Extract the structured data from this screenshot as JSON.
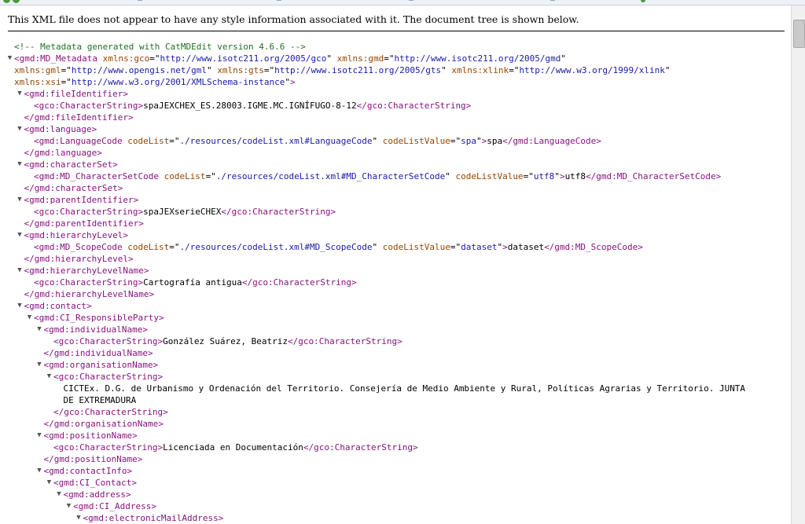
{
  "browser": {
    "info_message": "This XML file does not appear to have any style information associated with it. The document tree is shown below."
  },
  "icons": {
    "expand": "triangle-down-icon"
  },
  "xml_lines": [
    {
      "d": 0,
      "t": false,
      "s": [
        {
          "c": "cm",
          "v": "<!-- Metadata generated with CatMDEdit version 4.6.6 -->"
        }
      ]
    },
    {
      "d": 0,
      "t": true,
      "s": [
        {
          "c": "tag",
          "v": "<gmd:MD_Metadata"
        },
        {
          "c": "an",
          "v": " xmlns:gco"
        },
        {
          "c": "tx",
          "v": "=\""
        },
        {
          "c": "av",
          "v": "http://www.isotc211.org/2005/gco"
        },
        {
          "c": "tx",
          "v": "\""
        },
        {
          "c": "an",
          "v": " xmlns:gmd"
        },
        {
          "c": "tx",
          "v": "=\""
        },
        {
          "c": "av",
          "v": "http://www.isotc211.org/2005/gmd"
        },
        {
          "c": "tx",
          "v": "\""
        }
      ]
    },
    {
      "d": 0,
      "t": false,
      "s": [
        {
          "c": "an",
          "v": "xmlns:gml"
        },
        {
          "c": "tx",
          "v": "=\""
        },
        {
          "c": "av",
          "v": "http://www.opengis.net/gml"
        },
        {
          "c": "tx",
          "v": "\""
        },
        {
          "c": "an",
          "v": " xmlns:gts"
        },
        {
          "c": "tx",
          "v": "=\""
        },
        {
          "c": "av",
          "v": "http://www.isotc211.org/2005/gts"
        },
        {
          "c": "tx",
          "v": "\""
        },
        {
          "c": "an",
          "v": " xmlns:xlink"
        },
        {
          "c": "tx",
          "v": "=\""
        },
        {
          "c": "av",
          "v": "http://www.w3.org/1999/xlink"
        },
        {
          "c": "tx",
          "v": "\""
        }
      ]
    },
    {
      "d": 0,
      "t": false,
      "s": [
        {
          "c": "an",
          "v": "xmlns:xsi"
        },
        {
          "c": "tx",
          "v": "=\""
        },
        {
          "c": "av",
          "v": "http://www.w3.org/2001/XMLSchema-instance"
        },
        {
          "c": "tx",
          "v": "\""
        },
        {
          "c": "tag",
          "v": ">"
        }
      ]
    },
    {
      "d": 1,
      "t": true,
      "s": [
        {
          "c": "tag",
          "v": "<gmd:fileIdentifier>"
        }
      ]
    },
    {
      "d": 2,
      "t": false,
      "s": [
        {
          "c": "tag",
          "v": "<gco:CharacterString>"
        },
        {
          "c": "tx",
          "v": "spaJEXCHEX_ES.28003.IGME.MC.IGNÍFUGO-8-12"
        },
        {
          "c": "tag",
          "v": "</gco:CharacterString>"
        }
      ]
    },
    {
      "d": 1,
      "t": false,
      "s": [
        {
          "c": "tag",
          "v": "</gmd:fileIdentifier>"
        }
      ]
    },
    {
      "d": 1,
      "t": true,
      "s": [
        {
          "c": "tag",
          "v": "<gmd:language>"
        }
      ]
    },
    {
      "d": 2,
      "t": false,
      "s": [
        {
          "c": "tag",
          "v": "<gmd:LanguageCode"
        },
        {
          "c": "an",
          "v": " codeList"
        },
        {
          "c": "tx",
          "v": "=\""
        },
        {
          "c": "av",
          "v": "./resources/codeList.xml#LanguageCode"
        },
        {
          "c": "tx",
          "v": "\""
        },
        {
          "c": "an",
          "v": " codeListValue"
        },
        {
          "c": "tx",
          "v": "=\""
        },
        {
          "c": "av",
          "v": "spa"
        },
        {
          "c": "tx",
          "v": "\""
        },
        {
          "c": "tag",
          "v": ">"
        },
        {
          "c": "tx",
          "v": "spa"
        },
        {
          "c": "tag",
          "v": "</gmd:LanguageCode>"
        }
      ]
    },
    {
      "d": 1,
      "t": false,
      "s": [
        {
          "c": "tag",
          "v": "</gmd:language>"
        }
      ]
    },
    {
      "d": 1,
      "t": true,
      "s": [
        {
          "c": "tag",
          "v": "<gmd:characterSet>"
        }
      ]
    },
    {
      "d": 2,
      "t": false,
      "s": [
        {
          "c": "tag",
          "v": "<gmd:MD_CharacterSetCode"
        },
        {
          "c": "an",
          "v": " codeList"
        },
        {
          "c": "tx",
          "v": "=\""
        },
        {
          "c": "av",
          "v": "./resources/codeList.xml#MD_CharacterSetCode"
        },
        {
          "c": "tx",
          "v": "\""
        },
        {
          "c": "an",
          "v": " codeListValue"
        },
        {
          "c": "tx",
          "v": "=\""
        },
        {
          "c": "av",
          "v": "utf8"
        },
        {
          "c": "tx",
          "v": "\""
        },
        {
          "c": "tag",
          "v": ">"
        },
        {
          "c": "tx",
          "v": "utf8"
        },
        {
          "c": "tag",
          "v": "</gmd:MD_CharacterSetCode>"
        }
      ]
    },
    {
      "d": 1,
      "t": false,
      "s": [
        {
          "c": "tag",
          "v": "</gmd:characterSet>"
        }
      ]
    },
    {
      "d": 1,
      "t": true,
      "s": [
        {
          "c": "tag",
          "v": "<gmd:parentIdentifier>"
        }
      ]
    },
    {
      "d": 2,
      "t": false,
      "s": [
        {
          "c": "tag",
          "v": "<gco:CharacterString>"
        },
        {
          "c": "tx",
          "v": "spaJEXserieCHEX"
        },
        {
          "c": "tag",
          "v": "</gco:CharacterString>"
        }
      ]
    },
    {
      "d": 1,
      "t": false,
      "s": [
        {
          "c": "tag",
          "v": "</gmd:parentIdentifier>"
        }
      ]
    },
    {
      "d": 1,
      "t": true,
      "s": [
        {
          "c": "tag",
          "v": "<gmd:hierarchyLevel>"
        }
      ]
    },
    {
      "d": 2,
      "t": false,
      "s": [
        {
          "c": "tag",
          "v": "<gmd:MD_ScopeCode"
        },
        {
          "c": "an",
          "v": " codeList"
        },
        {
          "c": "tx",
          "v": "=\""
        },
        {
          "c": "av",
          "v": "./resources/codeList.xml#MD_ScopeCode"
        },
        {
          "c": "tx",
          "v": "\""
        },
        {
          "c": "an",
          "v": " codeListValue"
        },
        {
          "c": "tx",
          "v": "=\""
        },
        {
          "c": "av",
          "v": "dataset"
        },
        {
          "c": "tx",
          "v": "\""
        },
        {
          "c": "tag",
          "v": ">"
        },
        {
          "c": "tx",
          "v": "dataset"
        },
        {
          "c": "tag",
          "v": "</gmd:MD_ScopeCode>"
        }
      ]
    },
    {
      "d": 1,
      "t": false,
      "s": [
        {
          "c": "tag",
          "v": "</gmd:hierarchyLevel>"
        }
      ]
    },
    {
      "d": 1,
      "t": true,
      "s": [
        {
          "c": "tag",
          "v": "<gmd:hierarchyLevelName>"
        }
      ]
    },
    {
      "d": 2,
      "t": false,
      "s": [
        {
          "c": "tag",
          "v": "<gco:CharacterString>"
        },
        {
          "c": "tx",
          "v": "Cartografía antigua"
        },
        {
          "c": "tag",
          "v": "</gco:CharacterString>"
        }
      ]
    },
    {
      "d": 1,
      "t": false,
      "s": [
        {
          "c": "tag",
          "v": "</gmd:hierarchyLevelName>"
        }
      ]
    },
    {
      "d": 1,
      "t": true,
      "s": [
        {
          "c": "tag",
          "v": "<gmd:contact>"
        }
      ]
    },
    {
      "d": 2,
      "t": true,
      "s": [
        {
          "c": "tag",
          "v": "<gmd:CI_ResponsibleParty>"
        }
      ]
    },
    {
      "d": 3,
      "t": true,
      "s": [
        {
          "c": "tag",
          "v": "<gmd:individualName>"
        }
      ]
    },
    {
      "d": 4,
      "t": false,
      "s": [
        {
          "c": "tag",
          "v": "<gco:CharacterString>"
        },
        {
          "c": "tx",
          "v": "González Suárez, Beatriz"
        },
        {
          "c": "tag",
          "v": "</gco:CharacterString>"
        }
      ]
    },
    {
      "d": 3,
      "t": false,
      "s": [
        {
          "c": "tag",
          "v": "</gmd:individualName>"
        }
      ]
    },
    {
      "d": 3,
      "t": true,
      "s": [
        {
          "c": "tag",
          "v": "<gmd:organisationName>"
        }
      ]
    },
    {
      "d": 4,
      "t": true,
      "s": [
        {
          "c": "tag",
          "v": "<gco:CharacterString>"
        }
      ]
    },
    {
      "d": 5,
      "t": false,
      "s": [
        {
          "c": "tx",
          "v": "CICTEx. D.G. de Urbanismo y Ordenación del Territorio. Consejería de Medio Ambiente y Rural, Políticas Agrarias y Territorio. JUNTA"
        }
      ]
    },
    {
      "d": 5,
      "t": false,
      "s": [
        {
          "c": "tx",
          "v": "DE EXTREMADURA"
        }
      ]
    },
    {
      "d": 4,
      "t": false,
      "s": [
        {
          "c": "tag",
          "v": "</gco:CharacterString>"
        }
      ]
    },
    {
      "d": 3,
      "t": false,
      "s": [
        {
          "c": "tag",
          "v": "</gmd:organisationName>"
        }
      ]
    },
    {
      "d": 3,
      "t": true,
      "s": [
        {
          "c": "tag",
          "v": "<gmd:positionName>"
        }
      ]
    },
    {
      "d": 4,
      "t": false,
      "s": [
        {
          "c": "tag",
          "v": "<gco:CharacterString>"
        },
        {
          "c": "tx",
          "v": "Licenciada en Documentación"
        },
        {
          "c": "tag",
          "v": "</gco:CharacterString>"
        }
      ]
    },
    {
      "d": 3,
      "t": false,
      "s": [
        {
          "c": "tag",
          "v": "</gmd:positionName>"
        }
      ]
    },
    {
      "d": 3,
      "t": true,
      "s": [
        {
          "c": "tag",
          "v": "<gmd:contactInfo>"
        }
      ]
    },
    {
      "d": 4,
      "t": true,
      "s": [
        {
          "c": "tag",
          "v": "<gmd:CI_Contact>"
        }
      ]
    },
    {
      "d": 5,
      "t": true,
      "s": [
        {
          "c": "tag",
          "v": "<gmd:address>"
        }
      ]
    },
    {
      "d": 6,
      "t": true,
      "s": [
        {
          "c": "tag",
          "v": "<gmd:CI_Address>"
        }
      ]
    },
    {
      "d": 7,
      "t": true,
      "s": [
        {
          "c": "tag",
          "v": "<gmd:electronicMailAddress>"
        }
      ]
    }
  ]
}
